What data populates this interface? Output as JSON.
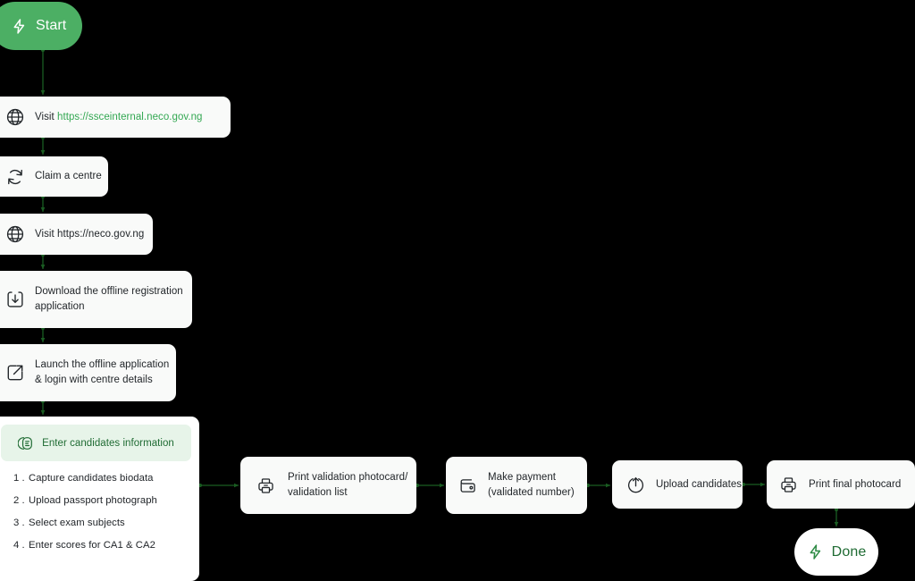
{
  "canvas": {
    "background": "#000000",
    "card_bg": "#f9faf9",
    "accent_green": "#34a853",
    "start_green": "#4caf64",
    "edge_green": "#1a5c22",
    "header_green_bg": "#e7f4e9",
    "header_green_text": "#1f6b33",
    "text_color": "#22262a"
  },
  "terminals": {
    "start": {
      "label": "Start",
      "icon": "lightning-bolt-icon"
    },
    "done": {
      "label": "Done",
      "icon": "lightning-bolt-icon"
    }
  },
  "nodes": {
    "visit_sscinternal": {
      "icon": "globe-icon",
      "prefix": "Visit ",
      "link": "https://ssceinternal.neco.gov.ng"
    },
    "claim_centre": {
      "icon": "refresh-icon",
      "line1": "Claim a centre"
    },
    "visit_neco": {
      "icon": "globe-icon",
      "line1": "Visit https://neco.gov.ng"
    },
    "download_app": {
      "icon": "download-icon",
      "line1": "Download the offline registration",
      "line2": "application"
    },
    "launch_app": {
      "icon": "external-link-icon",
      "line1": "Launch the offline application",
      "line2": "& login with centre details"
    },
    "print_validation": {
      "icon": "printer-icon",
      "line1": "Print validation photocard/",
      "line2": "validation list"
    },
    "make_payment": {
      "icon": "wallet-icon",
      "line1": "Make payment",
      "line2": "(validated number)"
    },
    "upload_candidates": {
      "icon": "upload-icon",
      "line1": "Upload candidates"
    },
    "print_final": {
      "icon": "printer-icon",
      "line1": "Print final photocard"
    }
  },
  "candidates_card": {
    "header": {
      "icon": "id-card-icon",
      "title": "Enter candidates information"
    },
    "steps": [
      {
        "num": "1 .",
        "text": "Capture candidates biodata"
      },
      {
        "num": "2 .",
        "text": "Upload passport photograph"
      },
      {
        "num": "3 .",
        "text": "Select exam subjects"
      },
      {
        "num": "4 .",
        "text": "Enter scores for CA1 & CA2"
      }
    ]
  }
}
